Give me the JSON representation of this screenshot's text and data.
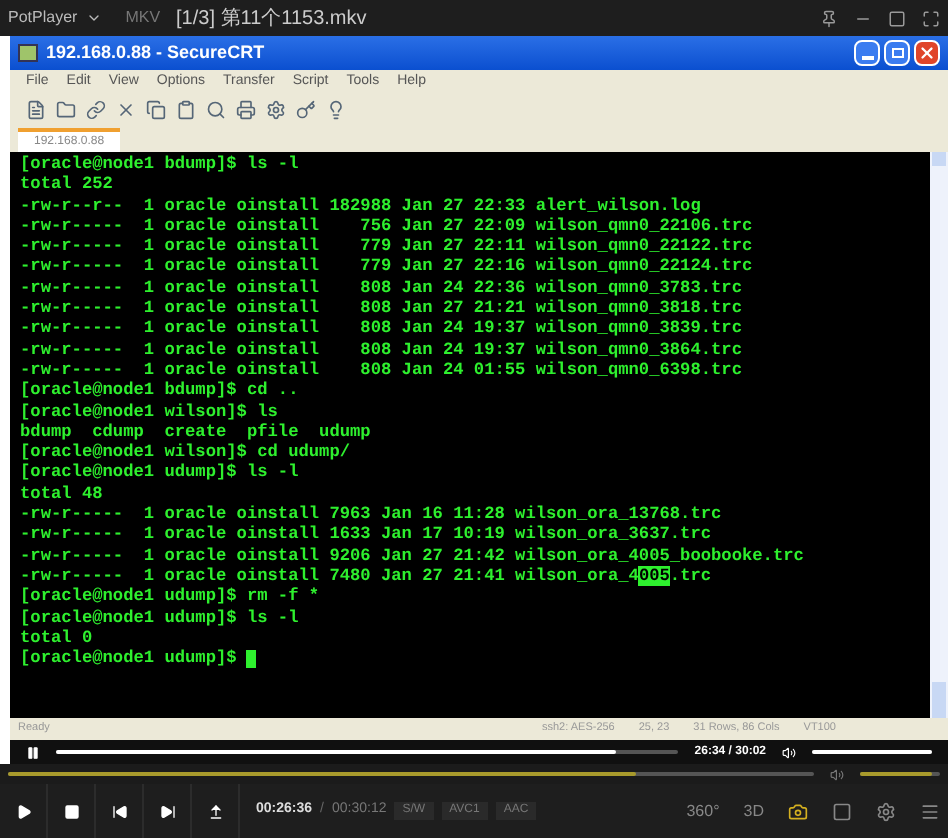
{
  "player": {
    "app_name": "PotPlayer",
    "format": "MKV",
    "file_title": "[1/3] 第11个1153.mkv"
  },
  "window": {
    "title": "192.168.0.88 - SecureCRT"
  },
  "menu": [
    "File",
    "Edit",
    "View",
    "Options",
    "Transfer",
    "Script",
    "Tools",
    "Help"
  ],
  "tabs": [
    {
      "label": "192.168.0.88",
      "selected": true
    }
  ],
  "terminal": {
    "lines": [
      {
        "kind": "plain",
        "text": "[oracle@node1 bdump]$ ls -l"
      },
      {
        "kind": "plain",
        "text": "total 252"
      },
      {
        "kind": "plain",
        "text": "-rw-r--r--  1 oracle oinstall 182988 Jan 27 22:33 alert_wilson.log"
      },
      {
        "kind": "plain",
        "text": "-rw-r-----  1 oracle oinstall    756 Jan 27 22:09 wilson_qmn0_22106.trc"
      },
      {
        "kind": "plain",
        "text": "-rw-r-----  1 oracle oinstall    779 Jan 27 22:11 wilson_qmn0_22122.trc"
      },
      {
        "kind": "plain",
        "text": "-rw-r-----  1 oracle oinstall    779 Jan 27 22:16 wilson_qmn0_22124.trc"
      },
      {
        "kind": "plain",
        "text": "-rw-r-----  1 oracle oinstall    808 Jan 24 22:36 wilson_qmn0_3783.trc"
      },
      {
        "kind": "plain",
        "text": "-rw-r-----  1 oracle oinstall    808 Jan 27 21:21 wilson_qmn0_3818.trc"
      },
      {
        "kind": "plain",
        "text": "-rw-r-----  1 oracle oinstall    808 Jan 24 19:37 wilson_qmn0_3839.trc"
      },
      {
        "kind": "plain",
        "text": "-rw-r-----  1 oracle oinstall    808 Jan 24 19:37 wilson_qmn0_3864.trc"
      },
      {
        "kind": "plain",
        "text": "-rw-r-----  1 oracle oinstall    808 Jan 24 01:55 wilson_qmn0_6398.trc"
      },
      {
        "kind": "plain",
        "text": "[oracle@node1 bdump]$ cd .."
      },
      {
        "kind": "plain",
        "text": "[oracle@node1 wilson]$ ls"
      },
      {
        "kind": "plain",
        "text": "bdump  cdump  create  pfile  udump"
      },
      {
        "kind": "plain",
        "text": "[oracle@node1 wilson]$ cd udump/"
      },
      {
        "kind": "plain",
        "text": "[oracle@node1 udump]$ ls -l"
      },
      {
        "kind": "plain",
        "text": "total 48"
      },
      {
        "kind": "plain",
        "text": "-rw-r-----  1 oracle oinstall 7963 Jan 16 11:28 wilson_ora_13768.trc"
      },
      {
        "kind": "plain",
        "text": "-rw-r-----  1 oracle oinstall 1633 Jan 17 10:19 wilson_ora_3637.trc"
      },
      {
        "kind": "plain",
        "text": "-rw-r-----  1 oracle oinstall 9206 Jan 27 21:42 wilson_ora_4005_boobooke.trc"
      },
      {
        "kind": "marked",
        "before": "-rw-r-----  1 oracle oinstall 7480 Jan 27 21:41 wilson_ora_4",
        "marked": "005",
        "after": ".trc"
      },
      {
        "kind": "plain",
        "text": "[oracle@node1 udump]$ rm -f *"
      },
      {
        "kind": "plain",
        "text": "[oracle@node1 udump]$ ls -l"
      },
      {
        "kind": "plain",
        "text": "total 0"
      },
      {
        "kind": "cursor",
        "text": "[oracle@node1 udump]$ "
      }
    ]
  },
  "status_bar": [
    "Ready",
    "ssh2: AES-256",
    "25, 23",
    "31 Rows, 86 Cols",
    "VT100"
  ],
  "video_bar": {
    "level": 0.9,
    "time": "26:34 / 30:02",
    "volume": {
      "level": 1
    }
  },
  "seek": {
    "level": 0.78,
    "volume": {
      "level": 0.9
    }
  },
  "controls": {
    "elapsed": "00:26:36",
    "separator": "/",
    "total": "00:30:12",
    "badges": [
      "S/W",
      "AVC1",
      "AAC"
    ],
    "right": [
      "360°",
      "3D"
    ]
  }
}
